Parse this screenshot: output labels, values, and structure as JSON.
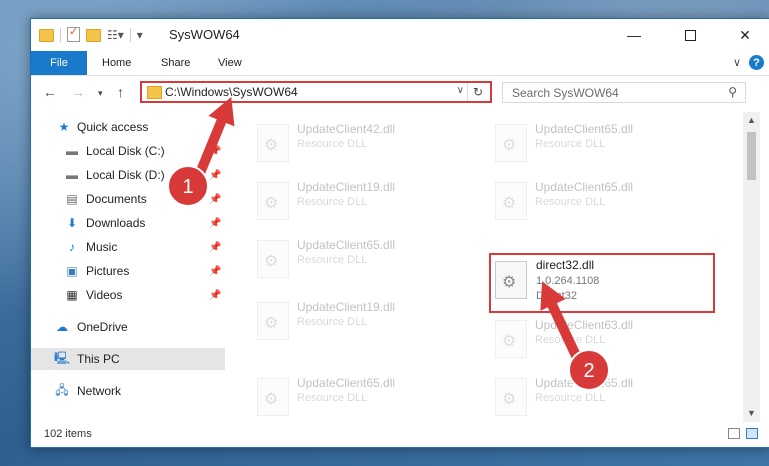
{
  "window": {
    "title": "SysWOW64"
  },
  "ribbon": {
    "file": "File",
    "home": "Home",
    "share": "Share",
    "view": "View",
    "help": "?"
  },
  "address": {
    "path": "C:\\Windows\\SysWOW64"
  },
  "search": {
    "placeholder": "Search SysWOW64"
  },
  "sidebar": {
    "items": [
      {
        "label": "Quick access",
        "icon": "star-icon"
      },
      {
        "label": "Local Disk (C:)",
        "icon": "drive-icon"
      },
      {
        "label": "Local Disk (D:)",
        "icon": "drive-icon"
      },
      {
        "label": "Documents",
        "icon": "documents-icon"
      },
      {
        "label": "Downloads",
        "icon": "download-icon"
      },
      {
        "label": "Music",
        "icon": "music-icon"
      },
      {
        "label": "Pictures",
        "icon": "pictures-icon"
      },
      {
        "label": "Videos",
        "icon": "videos-icon"
      },
      {
        "label": "OneDrive",
        "icon": "cloud-icon"
      },
      {
        "label": "This PC",
        "icon": "computer-icon"
      },
      {
        "label": "Network",
        "icon": "network-icon"
      }
    ]
  },
  "files": [
    {
      "name": "UpdateClient42.dll",
      "meta1": "Resource DLL",
      "meta2": ""
    },
    {
      "name": "UpdateClient65.dll",
      "meta1": "Resource DLL",
      "meta2": ""
    },
    {
      "name": "UpdateClient19.dll",
      "meta1": "Resource DLL",
      "meta2": ""
    },
    {
      "name": "UpdateClient65.dll",
      "meta1": "Resource DLL",
      "meta2": ""
    },
    {
      "name": "UpdateClient65.dll",
      "meta1": "Resource DLL",
      "meta2": ""
    },
    {
      "name": "direct32.dll",
      "meta1": "1.0.264.1108",
      "meta2": "Direct32"
    },
    {
      "name": "UpdateClient19.dll",
      "meta1": "Resource DLL",
      "meta2": ""
    },
    {
      "name": "UpdateClient63.dll",
      "meta1": "Resource DLL",
      "meta2": ""
    },
    {
      "name": "UpdateClient65.dll",
      "meta1": "Resource DLL",
      "meta2": ""
    },
    {
      "name": "UpdateClient65.dll",
      "meta1": "Resource DLL",
      "meta2": ""
    }
  ],
  "status": {
    "count": "102 items"
  },
  "annotations": {
    "step1": "1",
    "step2": "2",
    "color": "#d83a3a"
  }
}
